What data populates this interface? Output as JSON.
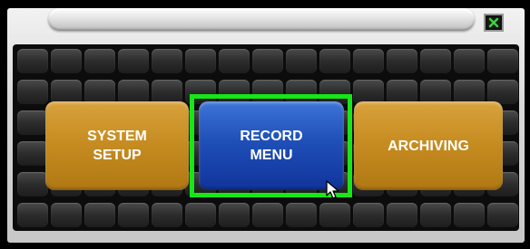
{
  "window": {
    "title": "",
    "close_icon": "close-x-icon"
  },
  "menu": {
    "buttons": [
      {
        "line1": "SYSTEM",
        "line2": "SETUP",
        "style": "gold",
        "selected": false
      },
      {
        "line1": "RECORD",
        "line2": "MENU",
        "style": "blue",
        "selected": true
      },
      {
        "line1": "ARCHIVING",
        "line2": "",
        "style": "gold",
        "selected": false
      }
    ]
  },
  "colors": {
    "gold_button": "#c78d22",
    "blue_button": "#1f4fb8",
    "selection_outline": "#17e617",
    "close_icon_green": "#3fd33f"
  },
  "icons": {
    "cursor": "mouse-pointer-icon"
  }
}
